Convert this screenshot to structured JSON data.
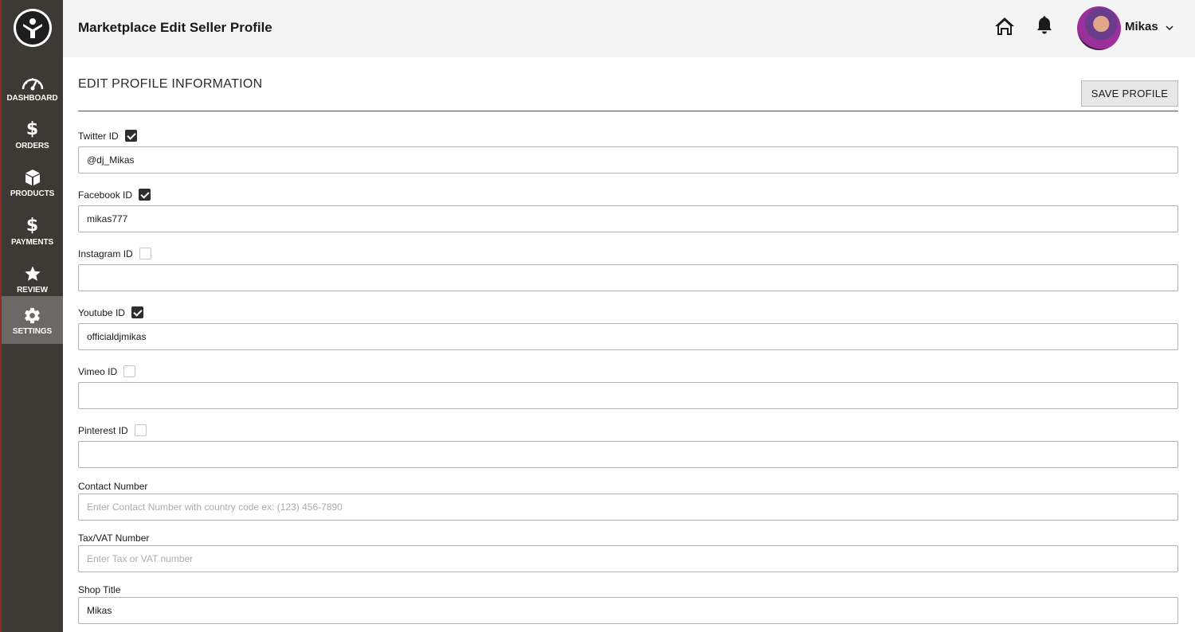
{
  "header": {
    "title": "Marketplace Edit Seller Profile",
    "user_name": "Mikas"
  },
  "sidebar": {
    "items": [
      {
        "label": "DASHBOARD",
        "icon": "gauge-icon"
      },
      {
        "label": "ORDERS",
        "icon": "dollar-icon"
      },
      {
        "label": "PRODUCTS",
        "icon": "box-icon"
      },
      {
        "label": "PAYMENTS",
        "icon": "dollar-icon"
      },
      {
        "label": "REVIEW",
        "icon": "star-icon"
      },
      {
        "label": "SETTINGS",
        "icon": "gear-icon",
        "active": true
      }
    ]
  },
  "main": {
    "section_title": "EDIT PROFILE INFORMATION",
    "save_label": "SAVE PROFILE",
    "fields": {
      "twitter": {
        "label": "Twitter ID",
        "checked": true,
        "value": "@dj_Mikas"
      },
      "facebook": {
        "label": "Facebook ID",
        "checked": true,
        "value": "mikas777"
      },
      "instagram": {
        "label": "Instagram ID",
        "checked": false,
        "value": ""
      },
      "youtube": {
        "label": "Youtube ID",
        "checked": true,
        "value": "officialdjmikas"
      },
      "vimeo": {
        "label": "Vimeo ID",
        "checked": false,
        "value": ""
      },
      "pinterest": {
        "label": "Pinterest ID",
        "checked": false,
        "value": ""
      },
      "contact": {
        "label": "Contact Number",
        "value": "",
        "placeholder": "Enter Contact Number with country code ex: (123) 456-7890"
      },
      "tax": {
        "label": "Tax/VAT Number",
        "value": "",
        "placeholder": "Enter Tax or VAT number"
      },
      "shop_title": {
        "label": "Shop Title",
        "value": "Mikas"
      }
    }
  },
  "colors": {
    "sidebar_bg": "#3d3935",
    "sidebar_active": "#6b6865",
    "header_bg": "#f4f4f4",
    "checkbox_checked": "#2e2e2e"
  }
}
